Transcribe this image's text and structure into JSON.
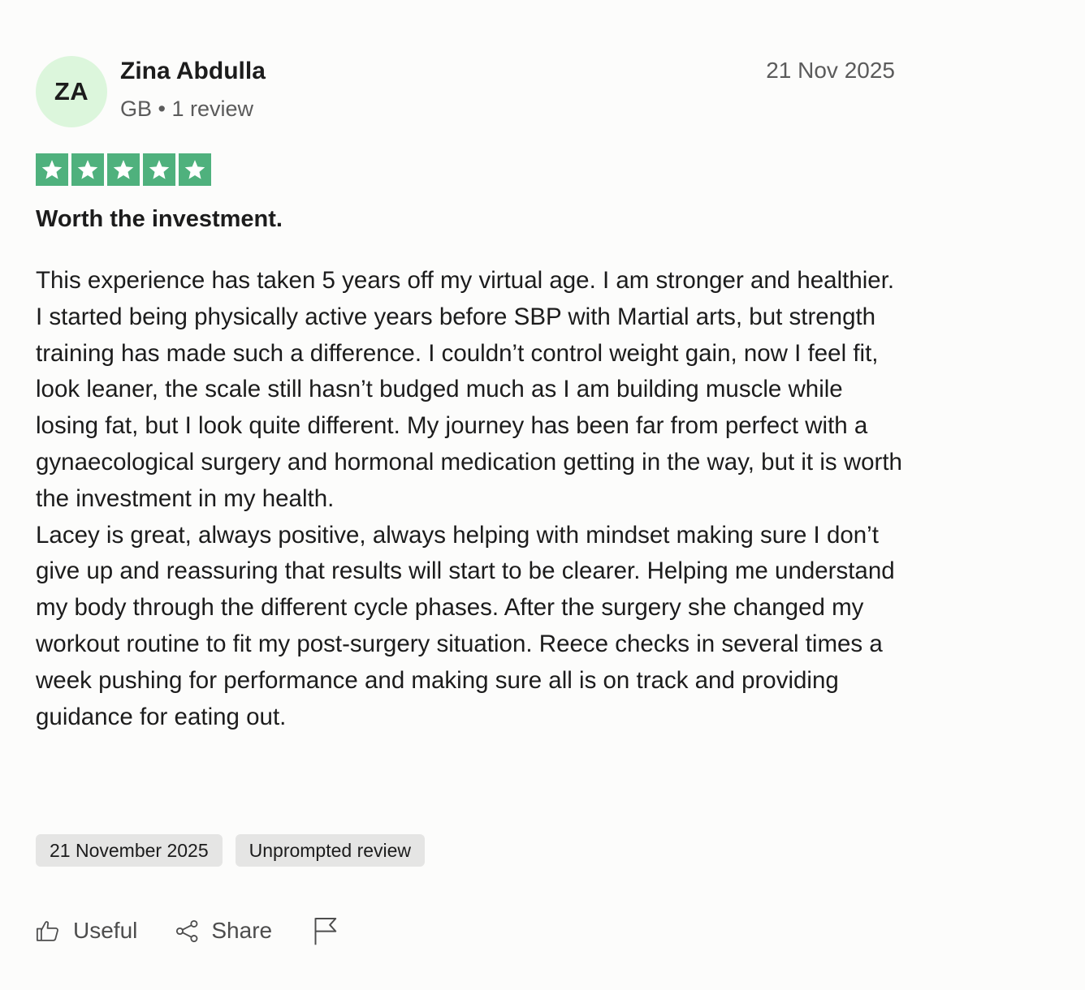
{
  "review": {
    "author": {
      "initials": "ZA",
      "name": "Zina Abdulla",
      "meta": "GB • 1 review"
    },
    "date_short": "21 Nov 2025",
    "rating": 5,
    "rating_max": 5,
    "title": "Worth the investment.",
    "body": [
      "This experience has taken 5 years off my virtual age. I am stronger and healthier. I started being physically active years before SBP with Martial arts, but strength training has made such a difference. I couldn’t control weight gain, now I feel fit, look leaner, the scale still hasn’t budged much as I am building muscle while losing fat, but I look quite different. My journey has been far from perfect with a gynaecological surgery and hormonal medication getting in the way, but it is worth the investment in my health.",
      "Lacey is great, always positive, always helping with mindset making sure I don’t give up and reassuring that results will start to be clearer. Helping me understand my body through the different cycle phases. After the surgery she changed my workout routine to fit my post-surgery situation. Reece checks in several times a week pushing for performance and making sure all is on track and providing guidance for eating out."
    ],
    "tags": {
      "date": "21 November 2025",
      "type": "Unprompted review"
    }
  },
  "actions": {
    "useful_label": "Useful",
    "share_label": "Share",
    "useful_icon": "thumbs-up-icon",
    "share_icon": "share-icon",
    "report_icon": "flag-icon"
  },
  "colors": {
    "star_fill": "#4fb17d",
    "avatar_bg": "#dcf6dc",
    "tag_bg": "#e5e5e4"
  }
}
